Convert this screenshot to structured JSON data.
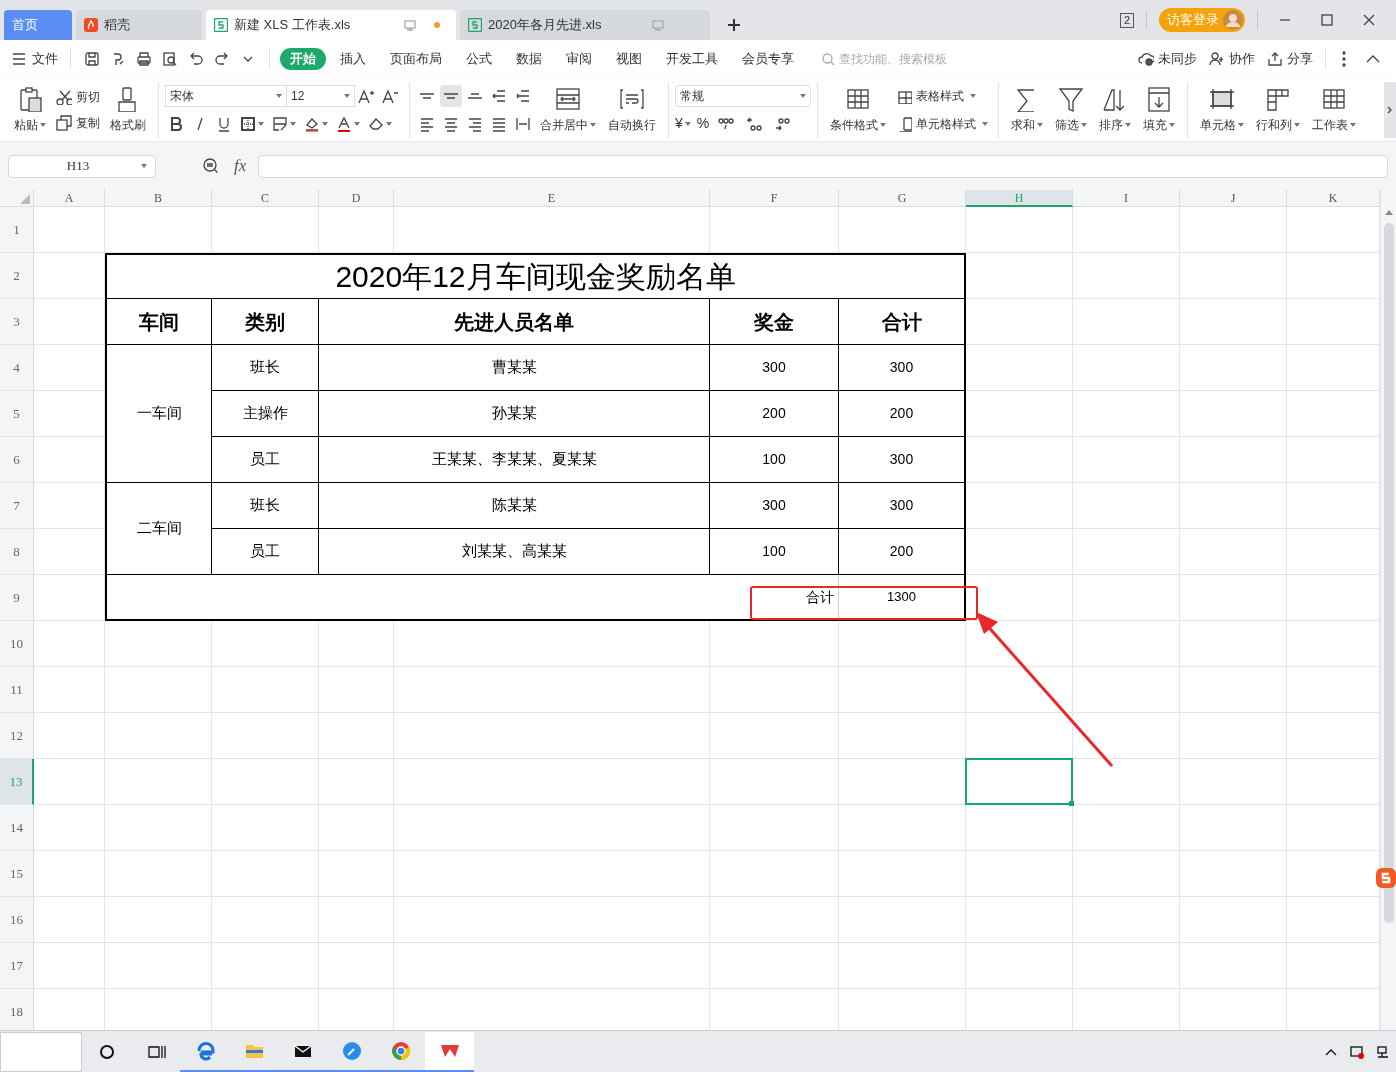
{
  "tabs": [
    {
      "kind": "home",
      "label": "首页",
      "selected": false
    },
    {
      "kind": "docer",
      "label": "稻壳",
      "selected": false
    },
    {
      "kind": "file",
      "label": "新建 XLS 工作表.xls",
      "selected": true,
      "unsaved": true
    },
    {
      "kind": "file",
      "label": "2020年各月先进.xls",
      "selected": false,
      "unsaved": false
    }
  ],
  "tab_count": "2",
  "login_button": "访客登录",
  "file_menu": "文件",
  "menu": [
    {
      "label": "开始",
      "selected": true
    },
    {
      "label": "插入",
      "selected": false
    },
    {
      "label": "页面布局",
      "selected": false
    },
    {
      "label": "公式",
      "selected": false
    },
    {
      "label": "数据",
      "selected": false
    },
    {
      "label": "审阅",
      "selected": false
    },
    {
      "label": "视图",
      "selected": false
    },
    {
      "label": "开发工具",
      "selected": false
    },
    {
      "label": "会员专享",
      "selected": false
    }
  ],
  "search": {
    "placeholder": "查找功能、搜索模板"
  },
  "menu_actions": [
    "未同步",
    "协作",
    "分享"
  ],
  "ribbon": {
    "paste": "粘贴",
    "cut": "剪切",
    "copy": "复制",
    "format_painter": "格式刷",
    "font": "宋体",
    "font_size": "12",
    "merge": "合并居中",
    "wrap": "自动换行",
    "number_format": "常规",
    "currency": "¥",
    "percent": "%",
    "styles": [
      {
        "label": "条件格式",
        "kind": "large"
      },
      {
        "label": "表格样式",
        "kind": "small"
      },
      {
        "label": "单元格样式",
        "kind": "small"
      }
    ],
    "tools": [
      "求和",
      "筛选",
      "排序",
      "填充"
    ],
    "cells": [
      "单元格",
      "行和列",
      "工作表"
    ]
  },
  "name_box": "H13",
  "fx": "fx",
  "columns": [
    {
      "label": "A",
      "selected": false
    },
    {
      "label": "B",
      "selected": false
    },
    {
      "label": "C",
      "selected": false
    },
    {
      "label": "D",
      "selected": false
    },
    {
      "label": "E",
      "selected": false
    },
    {
      "label": "F",
      "selected": false
    },
    {
      "label": "G",
      "selected": false
    },
    {
      "label": "H",
      "selected": true
    },
    {
      "label": "I",
      "selected": false
    },
    {
      "label": "J",
      "selected": false
    },
    {
      "label": "K",
      "selected": false
    }
  ],
  "rows": [
    {
      "label": "1",
      "selected": false
    },
    {
      "label": "2",
      "selected": false
    },
    {
      "label": "3",
      "selected": false
    },
    {
      "label": "4",
      "selected": false
    },
    {
      "label": "5",
      "selected": false
    },
    {
      "label": "6",
      "selected": false
    },
    {
      "label": "7",
      "selected": false
    },
    {
      "label": "8",
      "selected": false
    },
    {
      "label": "9",
      "selected": false
    },
    {
      "label": "10",
      "selected": false
    },
    {
      "label": "11",
      "selected": false
    },
    {
      "label": "12",
      "selected": false
    },
    {
      "label": "13",
      "selected": true
    },
    {
      "label": "14",
      "selected": false
    },
    {
      "label": "15",
      "selected": false
    },
    {
      "label": "16",
      "selected": false
    },
    {
      "label": "17",
      "selected": false
    },
    {
      "label": "18",
      "selected": false
    }
  ],
  "table": {
    "title": "2020年12月车间现金奖励名单",
    "headers": [
      "车间",
      "类别",
      "先进人员名单",
      "奖金",
      "合计"
    ],
    "groups": [
      {
        "workshop": "一车间",
        "rows": [
          {
            "category": "班长",
            "names": "曹某某",
            "bonus": "300",
            "total": "300"
          },
          {
            "category": "主操作",
            "names": "孙某某",
            "bonus": "200",
            "total": "200"
          },
          {
            "category": "员工",
            "names": "王某某、李某某、夏某某",
            "bonus": "100",
            "total": "300"
          }
        ]
      },
      {
        "workshop": "二车间",
        "rows": [
          {
            "category": "班长",
            "names": "陈某某",
            "bonus": "300",
            "total": "300"
          },
          {
            "category": "员工",
            "names": "刘某某、高某某",
            "bonus": "100",
            "total": "200"
          }
        ]
      }
    ],
    "total_label": "合计",
    "total": "1300",
    "total_highlighted": true
  },
  "arrow": true
}
